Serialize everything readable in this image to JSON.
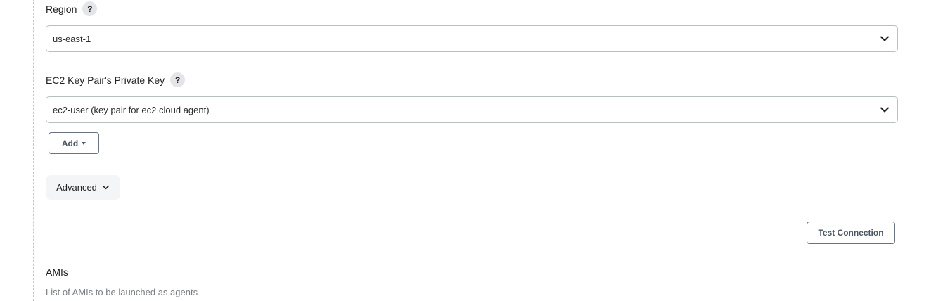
{
  "region": {
    "label": "Region",
    "help": "?",
    "value": "us-east-1"
  },
  "key_pair": {
    "label": "EC2 Key Pair's Private Key",
    "help": "?",
    "value": "ec2-user (key pair for ec2 cloud agent)",
    "add_label": "Add"
  },
  "advanced": {
    "label": "Advanced"
  },
  "test_connection": {
    "label": "Test Connection"
  },
  "amis": {
    "title": "AMIs",
    "description": "List of AMIs to be launched as agents"
  },
  "icons": {
    "help": "question-mark-icon",
    "select_arrow": "chevron-down-icon",
    "add_caret": "caret-down-icon"
  }
}
